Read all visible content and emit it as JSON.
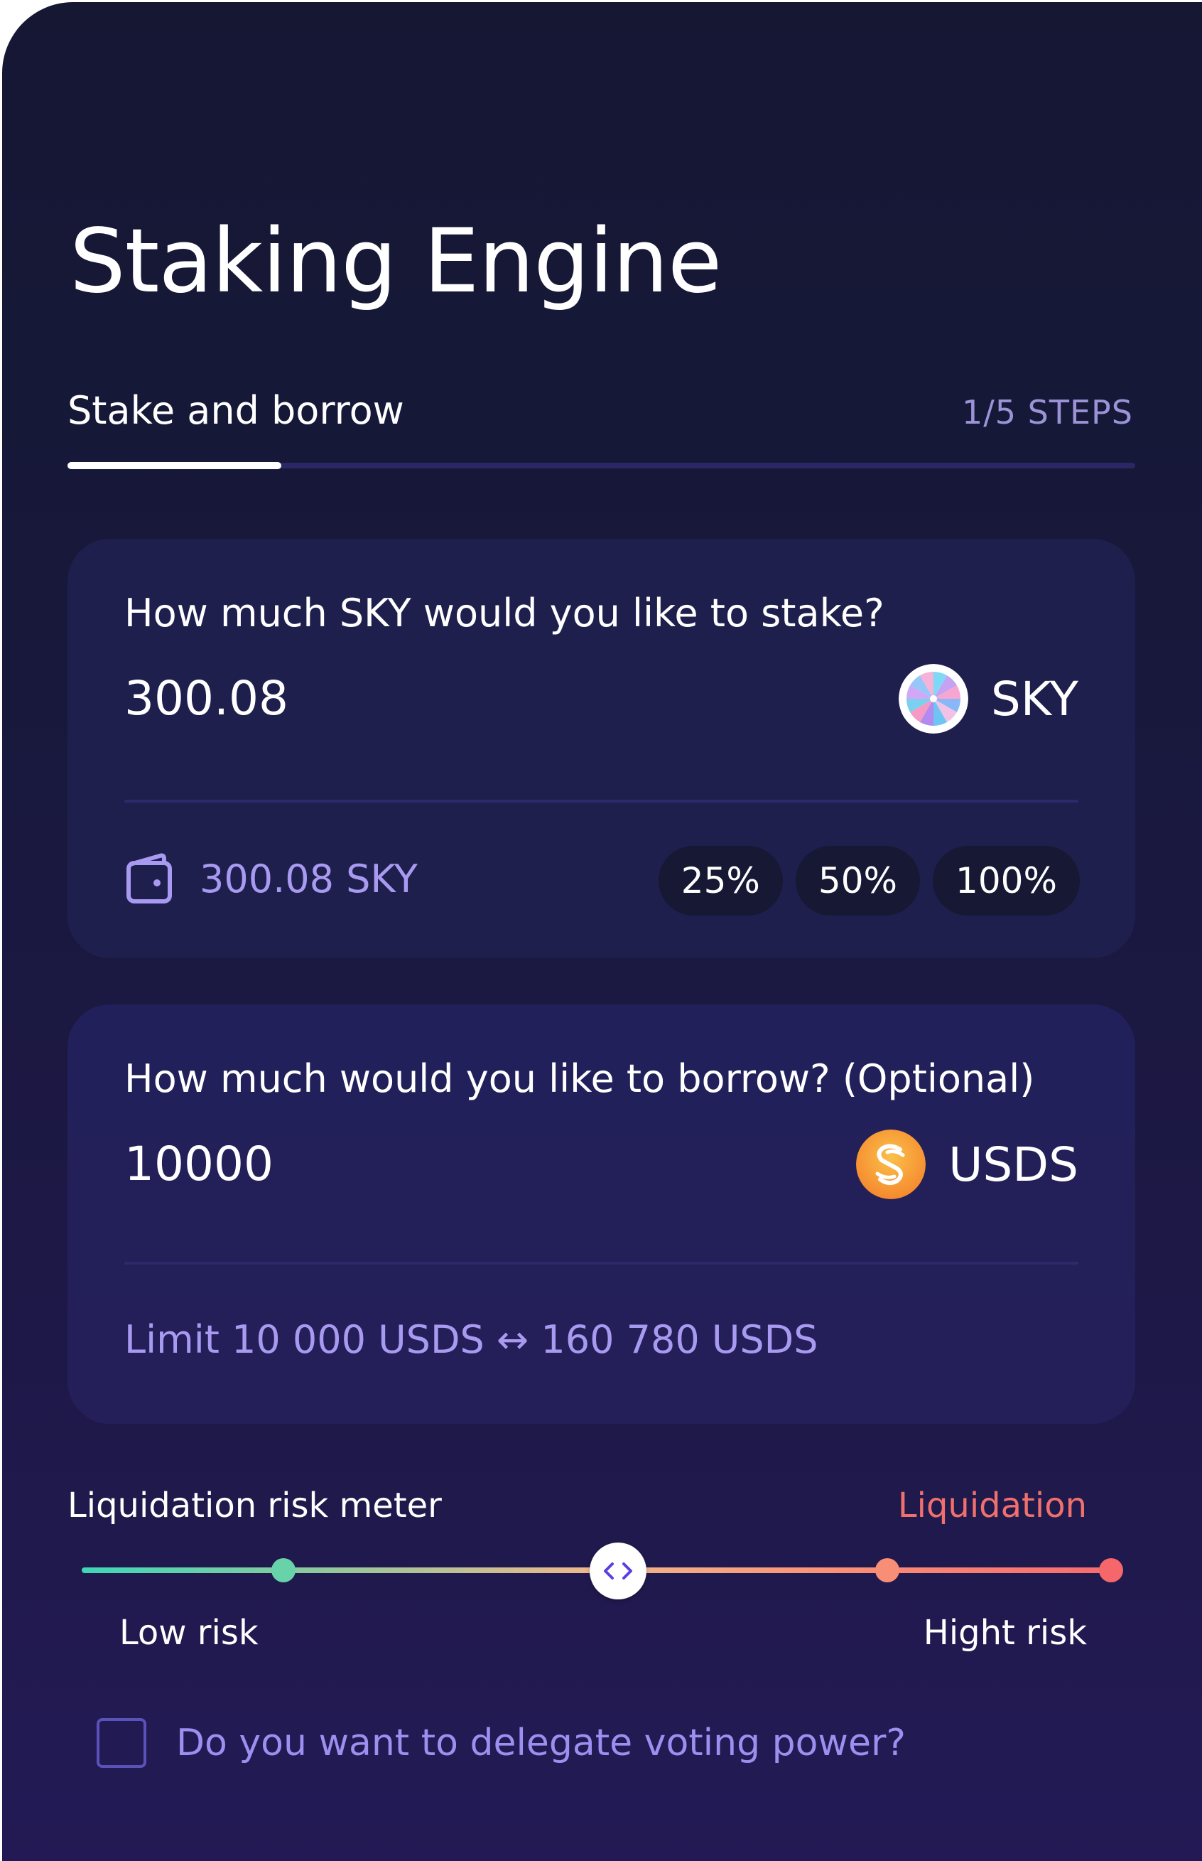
{
  "header": {
    "title": "Staking Engine",
    "step_label": "Stake and borrow",
    "step_count": "1/5 STEPS",
    "progress": 0.2
  },
  "stake": {
    "question": "How much SKY would you like to stake?",
    "amount": "300.08",
    "token": "SKY",
    "token_icon": "sky-token-icon",
    "balance_icon": "wallet-icon",
    "balance": "300.08 SKY",
    "percent_buttons": [
      "25%",
      "50%",
      "100%"
    ]
  },
  "borrow": {
    "question": "How much would you like to borrow? (Optional)",
    "amount": "10000",
    "token": "USDS",
    "token_icon": "usds-token-icon",
    "limit": "Limit 10 000 USDS ↔ 160 780 USDS"
  },
  "risk_meter": {
    "title": "Liquidation risk meter",
    "liquidation_label": "Liquidation",
    "low_label": "Low risk",
    "high_label": "Hight risk",
    "handle_icon": "code-brackets-icon",
    "handle_level": 0.5
  },
  "delegate": {
    "label": "Do you want to delegate voting power?",
    "checked": false
  },
  "colors": {
    "background": "#17183a",
    "card": "#1f1f4e",
    "accent_text": "#a89af0",
    "liquidation": "#f0706e",
    "low_risk": "#3ed7b7",
    "high_risk": "#f66b6e",
    "usds_orange": "#f6a03a"
  }
}
